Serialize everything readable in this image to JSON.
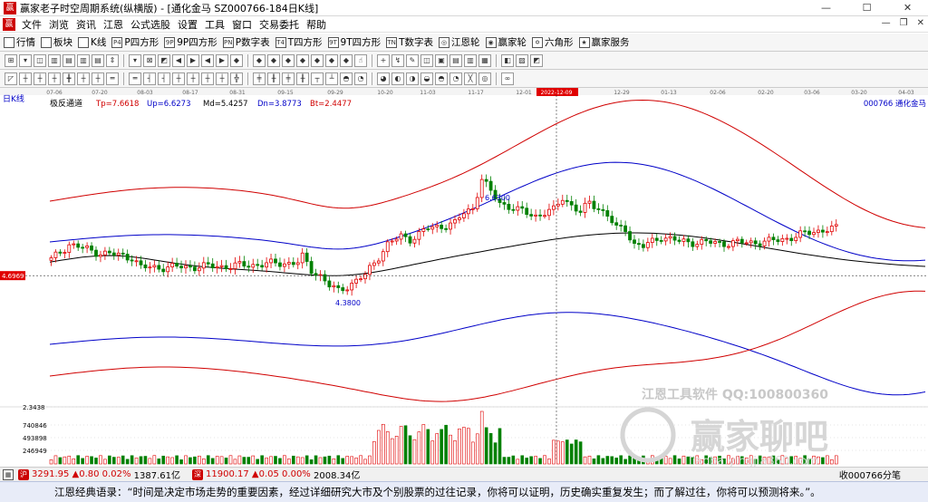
{
  "window": {
    "title": "赢家老子时空周期系统(纵横版) - [通化金马  SZ000766-184日K线]",
    "min": "—",
    "max": "☐",
    "close": "✕"
  },
  "menu": [
    "文件",
    "浏览",
    "资讯",
    "江恩",
    "公式选股",
    "设置",
    "工具",
    "窗口",
    "交易委托",
    "帮助"
  ],
  "mdi": {
    "min": "—",
    "restore": "❐",
    "close": "✕"
  },
  "nav": [
    {
      "label": "行情",
      "icon": "grid-icon"
    },
    {
      "label": "板块",
      "icon": "blocks-icon"
    },
    {
      "label": "K线",
      "icon": "kline-icon"
    },
    {
      "label": "P四方形",
      "icon": "p-square-icon",
      "glyph": "P4"
    },
    {
      "label": "9P四方形",
      "icon": "9p-square-icon",
      "glyph": "9P"
    },
    {
      "label": "P数字表",
      "icon": "p-table-icon",
      "glyph": "PN"
    },
    {
      "label": "T四方形",
      "icon": "t-square-icon",
      "glyph": "T4"
    },
    {
      "label": "9T四方形",
      "icon": "9t-square-icon",
      "glyph": "9T"
    },
    {
      "label": "T数字表",
      "icon": "t-table-icon",
      "glyph": "TN"
    },
    {
      "label": "江恩轮",
      "icon": "gann-wheel-icon",
      "glyph": "◎"
    },
    {
      "label": "赢家轮",
      "icon": "winner-wheel-icon",
      "glyph": "◉"
    },
    {
      "label": "六角形",
      "icon": "hexagon-icon",
      "glyph": "✡"
    },
    {
      "label": "赢家服务",
      "icon": "service-icon",
      "glyph": "★"
    }
  ],
  "toolbar1": [
    "⊞",
    "▾",
    "◫",
    "▥",
    "▤",
    "▥",
    "▤",
    "⇕",
    "▾",
    "⊠",
    "◩",
    "◀",
    "▶",
    "◀",
    "▶",
    "◆",
    "◆",
    "◆",
    "◆",
    "◆",
    "◆",
    "◆",
    "◆",
    "☝",
    "+",
    "↯",
    "✎",
    "◫",
    "▣",
    "▤",
    "▥",
    "▦",
    "◧",
    "▨",
    "◩"
  ],
  "toolbar2": [
    "◸",
    "┼",
    "┼",
    "┼",
    "╋",
    "┼",
    "┼",
    "═",
    "═",
    "┤",
    "┤",
    "┼",
    "┼",
    "┼",
    "┼",
    "╬",
    "╪",
    "╫",
    "╪",
    "╫",
    "┬",
    "┴",
    "◓",
    "◔",
    "◕",
    "◐",
    "◑",
    "◒",
    "◓",
    "◔",
    "╳",
    "◎",
    "∞"
  ],
  "chart": {
    "period_label": "日K线",
    "indicator": "极反通道",
    "params": [
      {
        "text": "Tp=7.6618",
        "color": "#d00000"
      },
      {
        "text": "Up=6.6273",
        "color": "#0000c8"
      },
      {
        "text": "Md=5.4257",
        "color": "#000000"
      },
      {
        "text": "Dn=3.8773",
        "color": "#0000c8"
      },
      {
        "text": "Bt=2.4477",
        "color": "#d00000"
      }
    ],
    "stock": "000766  通化金马",
    "dates": [
      "07-06",
      "07-20",
      "08-03",
      "08-17",
      "08-31",
      "09-15",
      "09-29",
      "10-20",
      "11-03",
      "11-17",
      "12-01",
      "2022-12-09",
      "12-29",
      "01-13",
      "02-06",
      "02-20",
      "03-06",
      "03-20",
      "04-03"
    ],
    "selected_date": "2022-12-09",
    "price_marker": "4.6969",
    "high_label": "6.6300",
    "low_label": "4.3800",
    "volume_scale": [
      "2.3438",
      "740846",
      "493898",
      "246949"
    ],
    "watermark_top": "江恩工具软件 QQ:100800360",
    "watermark_main": "赢家聊吧",
    "watermark_url": "liaoba.yingjia360.com",
    "colors": {
      "up": "#e00000",
      "down": "#008000",
      "tp": "#d00000",
      "up_band": "#0000c8",
      "md": "#000000"
    }
  },
  "status": {
    "idx1": {
      "value": "3291.95",
      "change": "▲0.80 0.02%",
      "amount": "1387.61亿"
    },
    "idx2": {
      "value": "11900.17",
      "change": "▲0.05 0.00%",
      "amount": "2008.34亿"
    },
    "right": "收000766分笔"
  },
  "quote": "江恩经典语录：“时间是决定市场走势的重要因素，经过详细研究大市及个别股票的过往记录，你将可以证明，历史确实重复发生；而了解过往，你将可以预测将来。”。"
}
